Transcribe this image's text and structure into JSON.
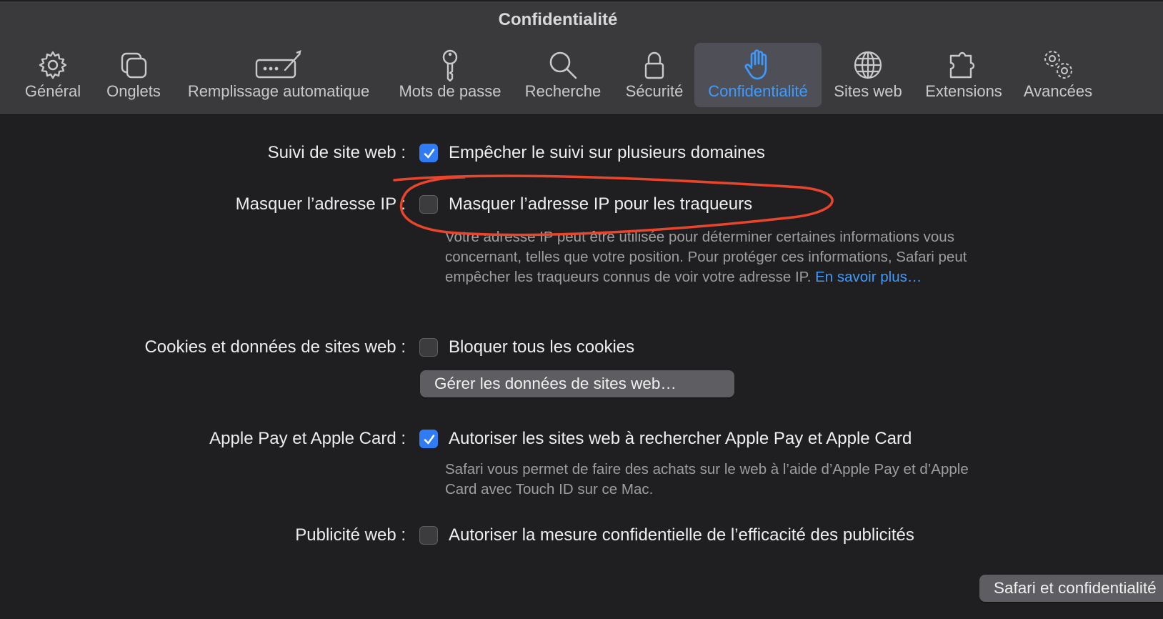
{
  "window": {
    "title": "Confidentialité"
  },
  "tabs": [
    {
      "label": "Général",
      "icon": "gear-icon"
    },
    {
      "label": "Onglets",
      "icon": "tabs-icon"
    },
    {
      "label": "Remplissage automatique",
      "icon": "autofill-icon"
    },
    {
      "label": "Mots de passe",
      "icon": "key-icon"
    },
    {
      "label": "Recherche",
      "icon": "search-icon"
    },
    {
      "label": "Sécurité",
      "icon": "lock-icon"
    },
    {
      "label": "Confidentialité",
      "icon": "hand-icon",
      "active": true
    },
    {
      "label": "Sites web",
      "icon": "globe-icon"
    },
    {
      "label": "Extensions",
      "icon": "puzzle-icon"
    },
    {
      "label": "Avancées",
      "icon": "gears-icon"
    }
  ],
  "settings": {
    "tracking": {
      "label": "Suivi de site web :",
      "option": "Empêcher le suivi sur plusieurs domaines",
      "checked": true
    },
    "hide_ip": {
      "label": "Masquer l’adresse IP :",
      "option": "Masquer l’adresse IP pour les traqueurs",
      "checked": false,
      "help": "Votre adresse IP peut être utilisée pour déterminer certaines informations vous concernant, telles que votre position. Pour protéger ces informations, Safari peut empêcher les traqueurs connus de voir votre adresse IP.",
      "link": "En savoir plus…"
    },
    "cookies": {
      "label": "Cookies et données de sites web :",
      "option": "Bloquer tous les cookies",
      "checked": false,
      "button": "Gérer les données de sites web…"
    },
    "apple_pay": {
      "label": "Apple Pay et Apple Card :",
      "option": "Autoriser les sites web à rechercher Apple Pay et Apple Card",
      "checked": true,
      "help": "Safari vous permet de faire des achats sur le web à l’aide d’Apple Pay et d’Apple Card avec Touch ID sur ce Mac."
    },
    "ads": {
      "label": "Publicité web :",
      "option": "Autoriser la mesure confidentielle de l’efficacité des publicités",
      "checked": false
    }
  },
  "footer": {
    "button": "Safari et confidentialité"
  },
  "colors": {
    "accent": "#3d9bff",
    "checkbox_checked": "#2f7cf6",
    "annotation": "#e8452c"
  }
}
